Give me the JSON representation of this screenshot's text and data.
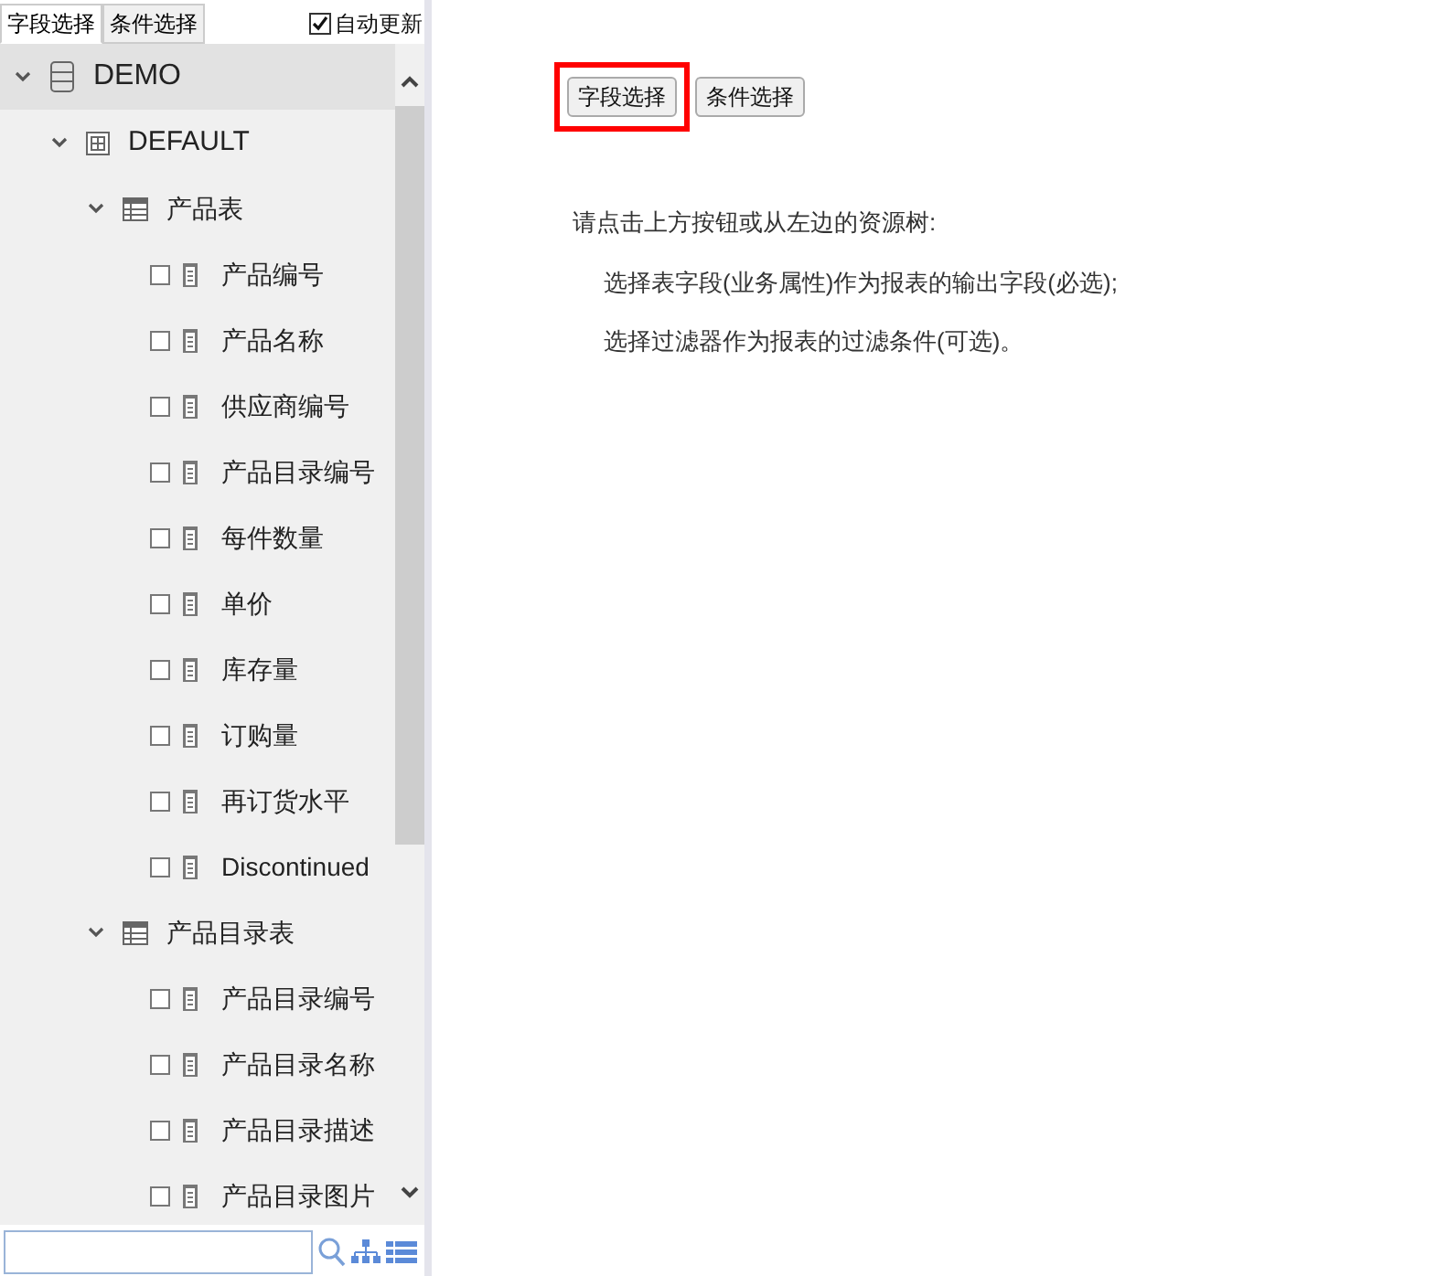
{
  "tabs": [
    {
      "label": "字段选择",
      "selected": true
    },
    {
      "label": "条件选择",
      "selected": false
    }
  ],
  "auto_update": {
    "label": "自动更新",
    "checked": true
  },
  "tree": [
    {
      "kind": "database",
      "label": "DEMO",
      "expanded": true,
      "selected": true,
      "children": [
        {
          "kind": "schema",
          "label": "DEFAULT",
          "expanded": true,
          "selected": false,
          "children": [
            {
              "kind": "table",
              "label": "产品表",
              "expanded": true,
              "selected": false,
              "children": [
                {
                  "kind": "field",
                  "label": "产品编号",
                  "checked": false
                },
                {
                  "kind": "field",
                  "label": "产品名称",
                  "checked": false
                },
                {
                  "kind": "field",
                  "label": "供应商编号",
                  "checked": false
                },
                {
                  "kind": "field",
                  "label": "产品目录编号",
                  "checked": false
                },
                {
                  "kind": "field",
                  "label": "每件数量",
                  "checked": false
                },
                {
                  "kind": "field",
                  "label": "单价",
                  "checked": false
                },
                {
                  "kind": "field",
                  "label": "库存量",
                  "checked": false
                },
                {
                  "kind": "field",
                  "label": "订购量",
                  "checked": false
                },
                {
                  "kind": "field",
                  "label": "再订货水平",
                  "checked": false
                },
                {
                  "kind": "field",
                  "label": "Discontinued",
                  "checked": false
                }
              ]
            },
            {
              "kind": "table",
              "label": "产品目录表",
              "expanded": true,
              "selected": false,
              "children": [
                {
                  "kind": "field",
                  "label": "产品目录编号",
                  "checked": false
                },
                {
                  "kind": "field",
                  "label": "产品目录名称",
                  "checked": false
                },
                {
                  "kind": "field",
                  "label": "产品目录描述",
                  "checked": false
                },
                {
                  "kind": "field",
                  "label": "产品目录图片",
                  "checked": false
                }
              ]
            }
          ]
        }
      ]
    }
  ],
  "buttons": [
    {
      "label": "字段选择",
      "highlighted": true
    },
    {
      "label": "条件选择",
      "highlighted": false
    }
  ],
  "instructions": [
    "请点击上方按钮或从左边的资源树:",
    "选择表字段(业务属性)作为报表的输出字段(必选);",
    "选择过滤器作为报表的过滤条件(可选)。"
  ]
}
